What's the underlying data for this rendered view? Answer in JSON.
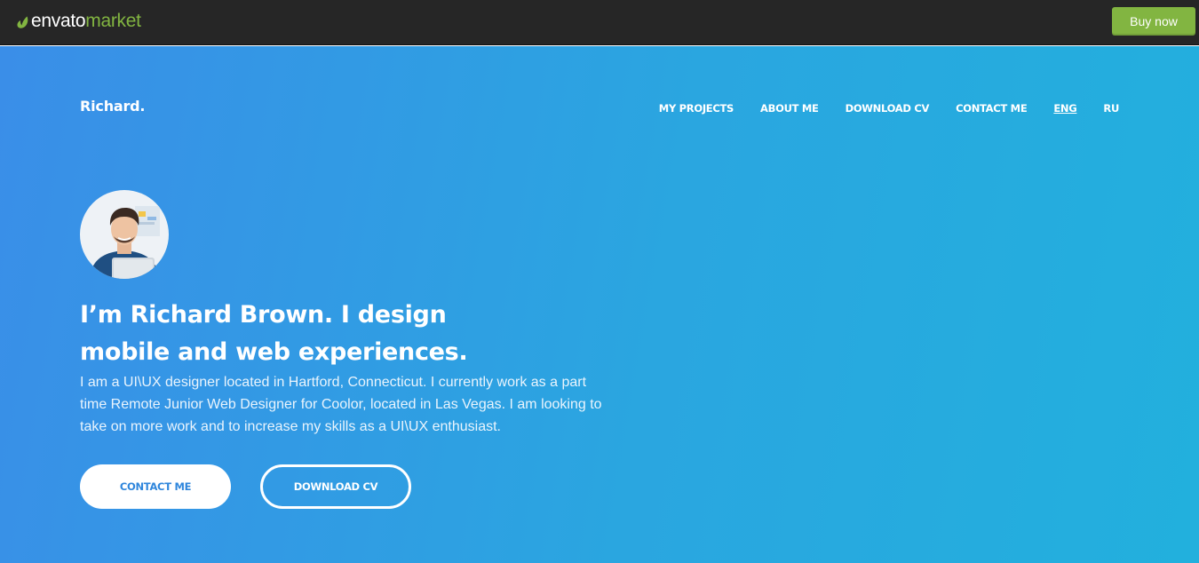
{
  "topbar": {
    "logo_brand": "envato",
    "logo_market": "market",
    "buy_label": "Buy now",
    "colors": {
      "bar": "#262626",
      "accent": "#82b541"
    }
  },
  "site": {
    "logo": "Richard.",
    "nav": [
      {
        "label": "MY PROJECTS"
      },
      {
        "label": "ABOUT ME"
      },
      {
        "label": "DOWNLOAD CV"
      },
      {
        "label": "CONTACT ME"
      },
      {
        "label": "ENG",
        "active": true
      },
      {
        "label": "RU"
      }
    ]
  },
  "hero": {
    "avatar_icon": "profile-photo",
    "headline_line1": "I’m Richard Brown. I design",
    "headline_line2": "mobile and web experiences.",
    "bio": "I am a UI\\UX designer located in Hartford, Connecticut. I currently work as a part time Remote Junior Web Designer for Coolor, located in Las Vegas. I am looking to take on more work and to increase my skills as a UI\\UX enthusiast.",
    "contact_button": "CONTACT ME",
    "cv_button": "DOWNLOAD CV",
    "colors": {
      "gradient_start": "#3a8ee8",
      "gradient_end": "#22b0dd"
    }
  }
}
